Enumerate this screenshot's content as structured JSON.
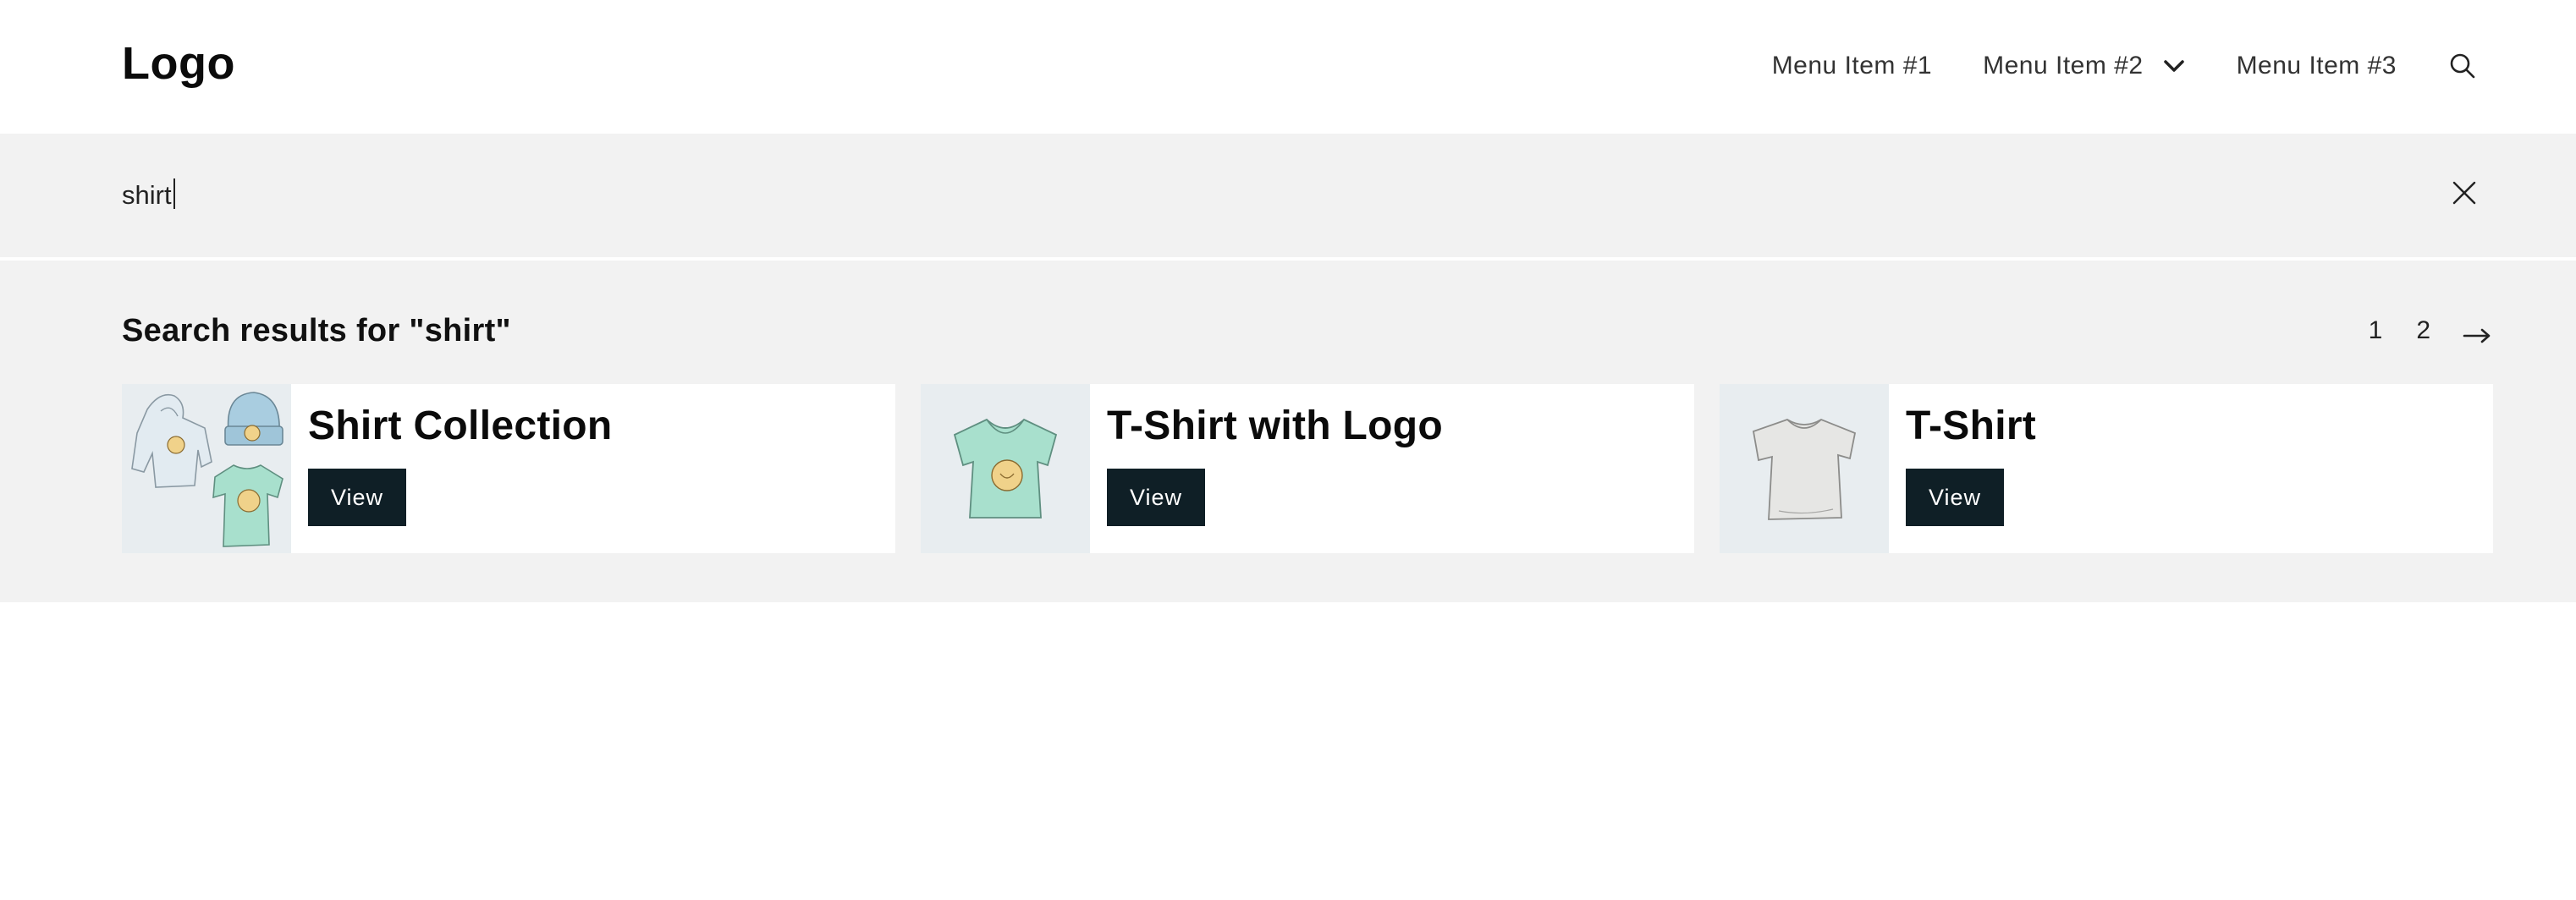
{
  "header": {
    "logo": "Logo",
    "nav": [
      {
        "label": "Menu Item #1",
        "icon": null
      },
      {
        "label": "Menu Item #2",
        "icon": "chevron-down-icon"
      },
      {
        "label": "Menu Item #3",
        "icon": null
      }
    ],
    "search_icon": "search-icon"
  },
  "search": {
    "value": "shirt",
    "close_icon": "close-icon"
  },
  "results": {
    "title": "Search results for \"shirt\"",
    "pagination": {
      "pages": [
        "1",
        "2"
      ],
      "next_icon": "arrow-right-icon"
    },
    "items": [
      {
        "title": "Shirt Collection",
        "button": "View",
        "image": "shirt-collection-illustration"
      },
      {
        "title": "T-Shirt with Logo",
        "button": "View",
        "image": "green-tshirt-illustration"
      },
      {
        "title": "T-Shirt",
        "button": "View",
        "image": "grey-tshirt-illustration"
      }
    ]
  },
  "colors": {
    "button_bg": "#0f1f26",
    "panel_bg": "#f2f2f2",
    "thumb_bg": "#e8edf0"
  }
}
